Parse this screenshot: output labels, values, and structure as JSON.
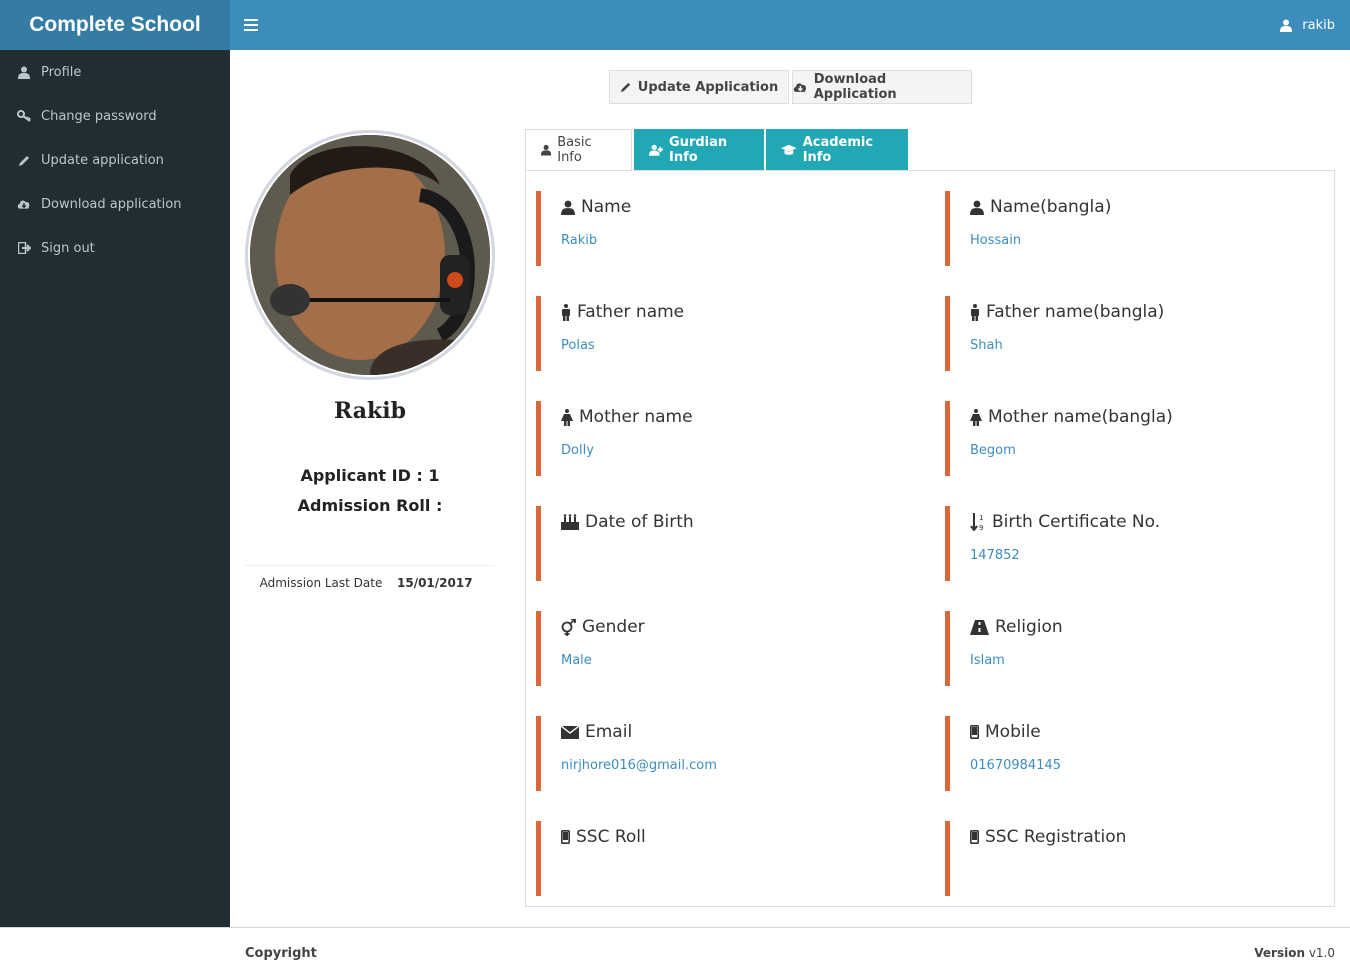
{
  "app": {
    "title": "Complete School"
  },
  "header": {
    "user_name": "rakib"
  },
  "sidebar": {
    "items": [
      {
        "label": "Profile",
        "icon": "user-icon"
      },
      {
        "label": "Change password",
        "icon": "key-icon"
      },
      {
        "label": "Update application",
        "icon": "pencil-icon"
      },
      {
        "label": "Download application",
        "icon": "cloud-download-icon"
      },
      {
        "label": "Sign out",
        "icon": "sign-out-icon"
      }
    ]
  },
  "actions": {
    "update_label": "Update Application",
    "download_label": "Download Application"
  },
  "profile": {
    "name": "Rakib",
    "applicant_id": "Applicant ID : 1",
    "admission_roll": "Admission Roll :",
    "last_date_label": "Admission Last Date",
    "last_date_value": "15/01/2017"
  },
  "tabs": [
    {
      "label": "Basic Info",
      "icon": "user-icon",
      "active": true
    },
    {
      "label": "Gurdian Info",
      "icon": "user-plus-icon",
      "active": false
    },
    {
      "label": "Academic Info",
      "icon": "graduation-cap-icon",
      "active": false
    }
  ],
  "fields": [
    {
      "label": "Name",
      "value": "Rakib",
      "icon": "user-icon"
    },
    {
      "label": "Name(bangla)",
      "value": "Hossain",
      "icon": "user-icon"
    },
    {
      "label": "Father name",
      "value": "Polas",
      "icon": "male-icon"
    },
    {
      "label": "Father name(bangla)",
      "value": "Shah",
      "icon": "male-icon"
    },
    {
      "label": "Mother name",
      "value": "Dolly",
      "icon": "female-icon"
    },
    {
      "label": "Mother name(bangla)",
      "value": "Begom",
      "icon": "female-icon"
    },
    {
      "label": "Date of Birth",
      "value": "",
      "icon": "birthday-cake-icon"
    },
    {
      "label": "Birth Certificate No.",
      "value": "147852",
      "icon": "sort-numeric-icon"
    },
    {
      "label": "Gender",
      "value": "Male",
      "icon": "transgender-icon"
    },
    {
      "label": "Religion",
      "value": "Islam",
      "icon": "road-icon"
    },
    {
      "label": "Email",
      "value": "nirjhore016@gmail.com",
      "icon": "envelope-icon"
    },
    {
      "label": "Mobile",
      "value": "01670984145",
      "icon": "mobile-icon"
    },
    {
      "label": "SSC Roll",
      "value": "",
      "icon": "mobile-icon"
    },
    {
      "label": "SSC Registration",
      "value": "",
      "icon": "mobile-icon"
    }
  ],
  "footer": {
    "copyright": "Copyright",
    "version_label": "Version",
    "version_value": "v1.0"
  },
  "colors": {
    "brand_bg": "#357ca5",
    "header_bg": "#3c8dbc",
    "sidebar_bg": "#222d32",
    "tab_bg": "#22a7b5",
    "field_accent": "#d9673a",
    "link": "#3c8dbc"
  }
}
